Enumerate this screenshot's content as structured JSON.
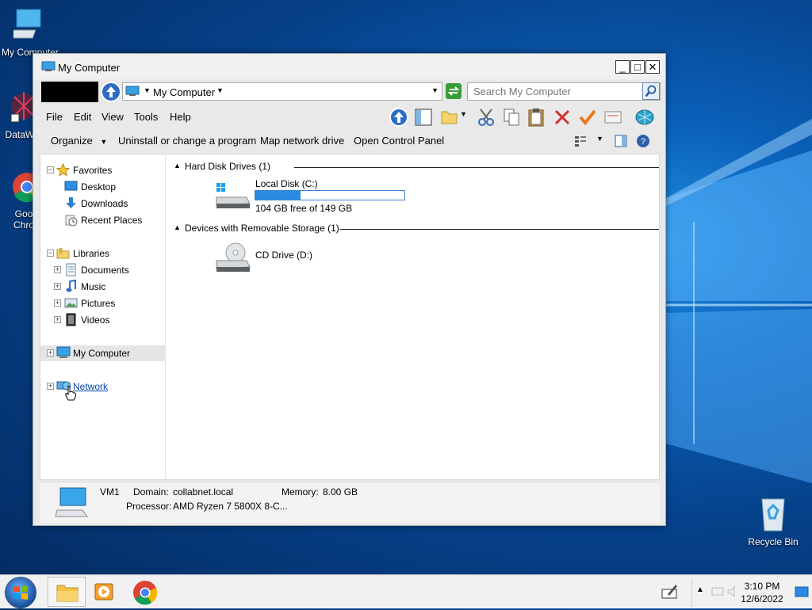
{
  "desktop": {
    "icons": [
      {
        "label": "My Computer"
      },
      {
        "label": "DataWa"
      },
      {
        "label": "Goo"
      },
      {
        "label": "Chro"
      },
      {
        "label": "Recycle Bin"
      }
    ]
  },
  "window": {
    "title": "My Computer",
    "buttons": {
      "minimize": "_",
      "maximize": "□",
      "close": "✕"
    },
    "address": {
      "location": "My Computer"
    },
    "search": {
      "placeholder": "Search My Computer"
    },
    "menu": [
      "File",
      "Edit",
      "View",
      "Tools",
      "Help"
    ],
    "commands": {
      "organize": "Organize",
      "uninstall": "Uninstall or change a program",
      "map_drive": "Map network drive",
      "control_panel": "Open Control Panel"
    }
  },
  "nav": {
    "favorites": "Favorites",
    "desktop": "Desktop",
    "downloads": "Downloads",
    "recent": "Recent Places",
    "libraries": "Libraries",
    "documents": "Documents",
    "music": "Music",
    "pictures": "Pictures",
    "videos": "Videos",
    "my_computer": "My Computer",
    "network": "Network"
  },
  "main": {
    "hdd_group": "Hard Disk Drives (1)",
    "removable_group": "Devices with Removable Storage (1)",
    "local_disk": {
      "name": "Local Disk (C:)",
      "free_text": "104 GB free of 149 GB",
      "used_fraction": 0.302
    },
    "cd_drive": {
      "name": "CD Drive (D:)"
    }
  },
  "details": {
    "name": "VM1",
    "domain_label": "Domain:",
    "domain_value": "collabnet.local",
    "memory_label": "Memory:",
    "memory_value": "8.00 GB",
    "processor_label": "Processor:",
    "processor_value": "AMD Ryzen 7 5800X 8-C..."
  },
  "taskbar": {
    "time": "3:10 PM",
    "date": "12/6/2022"
  },
  "colors": {
    "accent": "#2a8be3",
    "link": "#0645ad"
  }
}
